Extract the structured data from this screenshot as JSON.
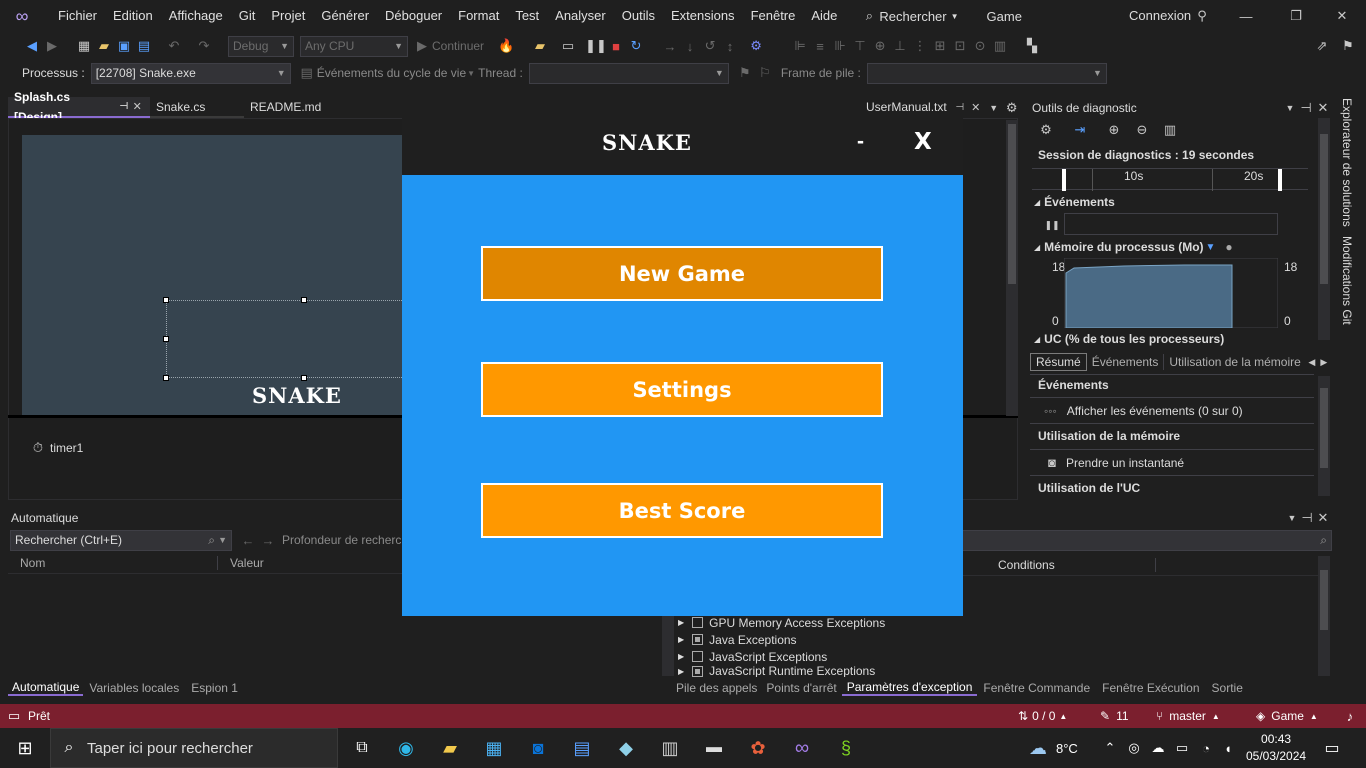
{
  "menubar": {
    "items": [
      "Fichier",
      "Edition",
      "Affichage",
      "Git",
      "Projet",
      "Générer",
      "Déboguer",
      "Format",
      "Test",
      "Analyser",
      "Outils",
      "Extensions",
      "Fenêtre",
      "Aide"
    ],
    "search_label": "Rechercher",
    "solution_name": "Game",
    "signin": "Connexion"
  },
  "toolbar": {
    "config": "Debug",
    "platform": "Any CPU",
    "continue": "Continuer"
  },
  "toolbar2": {
    "process_label": "Processus :",
    "process_value": "[22708] Snake.exe",
    "lifecycle_label": "Événements du cycle de vie",
    "thread_label": "Thread :",
    "stackframe_label": "Frame de pile :"
  },
  "tabs": [
    {
      "label": "Splash.cs [Design]",
      "active": true
    },
    {
      "label": "Snake.cs",
      "active": false
    },
    {
      "label": "README.md",
      "active": false
    }
  ],
  "right_tab": "UserManual.txt",
  "designer": {
    "logo": "SNAKE",
    "component": "timer1"
  },
  "diagnostics": {
    "title": "Outils de diagnostic",
    "session": "Session de diagnostics : 19 secondes",
    "ticks": [
      "10s",
      "20s"
    ],
    "events_header": "Événements",
    "memory_header": "Mémoire du processus (Mo)",
    "memory_max_left": "18",
    "memory_min_left": "0",
    "memory_max_right": "18",
    "memory_min_right": "0",
    "cpu_header": "UC (% de tous les processeurs)",
    "tabs": [
      "Résumé",
      "Événements",
      "Utilisation de la mémoire"
    ],
    "summary": {
      "events_title": "Événements",
      "events_link": "Afficher les événements (0 sur 0)",
      "memory_title": "Utilisation de la mémoire",
      "memory_link": "Prendre un instantané",
      "cpu_title": "Utilisation de l'UC"
    }
  },
  "autos": {
    "title": "Automatique",
    "search_placeholder": "Rechercher (Ctrl+E)",
    "depth_label": "Profondeur de recherch",
    "col_name": "Nom",
    "col_value": "Valeur",
    "bottom_tabs": [
      "Automatique",
      "Variables locales",
      "Espion 1"
    ]
  },
  "exceptions": {
    "col_conditions": "Conditions",
    "items": [
      {
        "label": "GPU Memory Access Exceptions",
        "checked": false
      },
      {
        "label": "Java Exceptions",
        "checked": true
      },
      {
        "label": "JavaScript Exceptions",
        "checked": false
      },
      {
        "label": "JavaScript Runtime Exceptions",
        "checked": true
      }
    ],
    "bottom_tabs": [
      "Pile des appels",
      "Points d'arrêt",
      "Paramètres d'exception",
      "Fenêtre Commande",
      "Fenêtre Exécution",
      "Sortie"
    ]
  },
  "sidebar_tabs": [
    "Explorateur de solutions",
    "Modifications Git"
  ],
  "status": {
    "ready": "Prêt",
    "sync": "0 / 0",
    "edits": "11",
    "branch": "master",
    "repo": "Game"
  },
  "taskbar": {
    "search_placeholder": "Taper ici pour rechercher",
    "weather": "8°C",
    "time": "00:43",
    "date": "05/03/2024"
  },
  "snake_app": {
    "title": "SNAKE",
    "minimize": "-",
    "close": "X",
    "buttons": [
      "New Game",
      "Settings",
      "Best Score"
    ],
    "colors": {
      "background": "#2196f3",
      "button": "#ff9800",
      "button_hover": "#e08600",
      "titlebar": "#1f1f1f"
    }
  }
}
